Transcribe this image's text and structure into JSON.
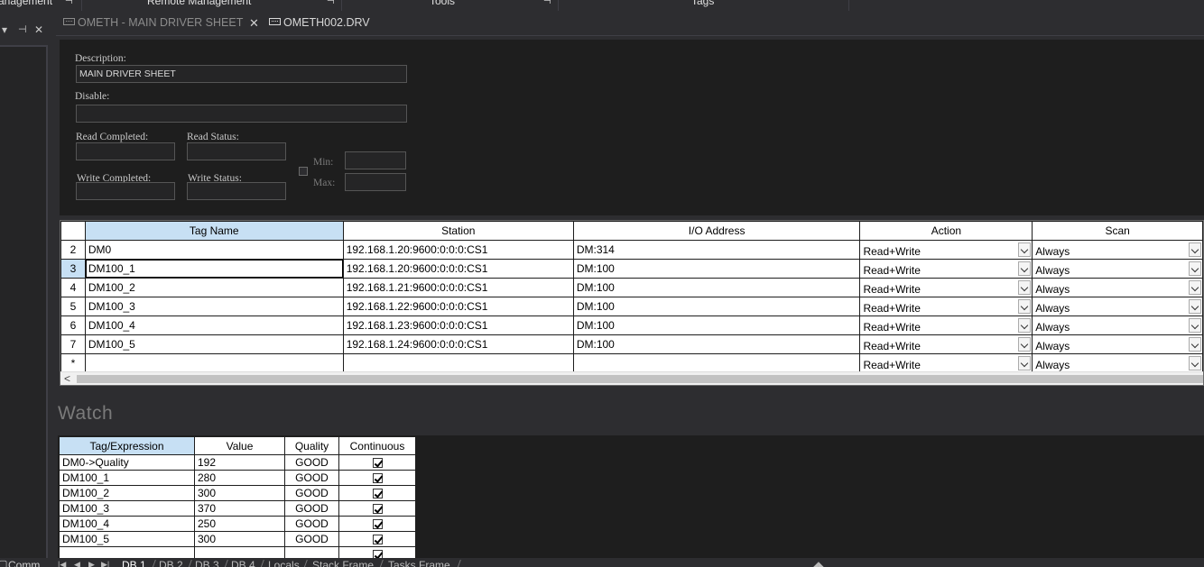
{
  "top_panels": {
    "items": [
      "anagement",
      "Remote Management",
      "Tools",
      "Tags"
    ],
    "pin_glyph": "⊣"
  },
  "left_panel": {
    "dropdown_glyph": "▾",
    "pin_glyph": "⊣",
    "close_glyph": "✕"
  },
  "doc_tabs": [
    {
      "label": "OMETH - MAIN DRIVER SHEET",
      "active": false,
      "icon": "grid-sheet-icon"
    },
    {
      "label": "OMETH002.DRV",
      "active": true,
      "icon": "grid-sheet-icon"
    }
  ],
  "doc_tab_close": "✕",
  "form": {
    "description_label": "Description:",
    "description_value": "MAIN DRIVER SHEET",
    "disable_label": "Disable:",
    "disable_value": "",
    "read_completed_label": "Read Completed:",
    "read_status_label": "Read Status:",
    "write_completed_label": "Write Completed:",
    "write_status_label": "Write Status:",
    "min_label": "Min:",
    "max_label": "Max:"
  },
  "grid": {
    "columns": [
      "Tag Name",
      "Station",
      "I/O Address",
      "Action",
      "Scan"
    ],
    "rows": [
      {
        "num": "2",
        "tag": "DM0",
        "station": "192.168.1.20:9600:0:0:0:CS1",
        "address": "DM:314",
        "action": "Read+Write",
        "scan": "Always"
      },
      {
        "num": "3",
        "tag": "DM100_1",
        "station": "192.168.1.20:9600:0:0:0:CS1",
        "address": "DM:100",
        "action": "Read+Write",
        "scan": "Always"
      },
      {
        "num": "4",
        "tag": "DM100_2",
        "station": "192.168.1.21:9600:0:0:0:CS1",
        "address": "DM:100",
        "action": "Read+Write",
        "scan": "Always"
      },
      {
        "num": "5",
        "tag": "DM100_3",
        "station": "192.168.1.22:9600:0:0:0:CS1",
        "address": "DM:100",
        "action": "Read+Write",
        "scan": "Always"
      },
      {
        "num": "6",
        "tag": "DM100_4",
        "station": "192.168.1.23:9600:0:0:0:CS1",
        "address": "DM:100",
        "action": "Read+Write",
        "scan": "Always"
      },
      {
        "num": "7",
        "tag": "DM100_5",
        "station": "192.168.1.24:9600:0:0:0:CS1",
        "address": "DM:100",
        "action": "Read+Write",
        "scan": "Always"
      },
      {
        "num": "*",
        "tag": "",
        "station": "",
        "address": "",
        "action": "Read+Write",
        "scan": "Always"
      }
    ],
    "scroll_left_glyph": "<",
    "selected_row": "3"
  },
  "watch": {
    "title": "Watch",
    "columns": [
      "Tag/Expression",
      "Value",
      "Quality",
      "Continuous"
    ],
    "rows": [
      {
        "expr": "DM0->Quality",
        "value": "192",
        "quality": "GOOD",
        "continuous": true
      },
      {
        "expr": "DM100_1",
        "value": "280",
        "quality": "GOOD",
        "continuous": true
      },
      {
        "expr": "DM100_2",
        "value": "300",
        "quality": "GOOD",
        "continuous": true
      },
      {
        "expr": "DM100_3",
        "value": "370",
        "quality": "GOOD",
        "continuous": true
      },
      {
        "expr": "DM100_4",
        "value": "250",
        "quality": "GOOD",
        "continuous": true
      },
      {
        "expr": "DM100_5",
        "value": "300",
        "quality": "GOOD",
        "continuous": true
      },
      {
        "expr": "",
        "value": "",
        "quality": "",
        "continuous": true
      }
    ]
  },
  "bottom": {
    "left_label": "Comm",
    "nav_glyphs": [
      "|◀",
      "◀",
      "▶",
      "▶|"
    ],
    "tabs": [
      "DB 1",
      "DB 2",
      "DB 3",
      "DB 4",
      "Locals",
      "Stack Frame",
      "Tasks Frame"
    ],
    "active_tab": "DB 1"
  },
  "colors": {
    "background": "#2d2d30",
    "form_bg": "#1e1e1e",
    "selection": "#c7e0f4"
  }
}
